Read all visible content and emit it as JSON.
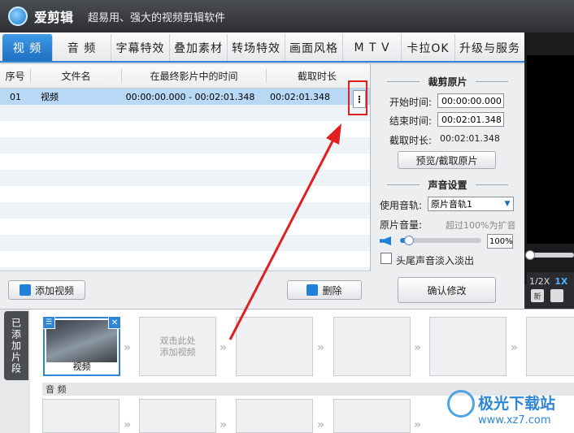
{
  "app": {
    "name": "爱剪辑",
    "slogan": "超易用、强大的视频剪辑软件"
  },
  "tabs": [
    {
      "label": "视 频",
      "active": true
    },
    {
      "label": "音 频",
      "active": false
    },
    {
      "label": "字幕特效",
      "active": false
    },
    {
      "label": "叠加素材",
      "active": false
    },
    {
      "label": "转场特效",
      "active": false
    },
    {
      "label": "画面风格",
      "active": false
    },
    {
      "label": "M T V",
      "active": false
    },
    {
      "label": "卡拉OK",
      "active": false
    },
    {
      "label": "升级与服务",
      "active": false
    }
  ],
  "table": {
    "headers": [
      "序号",
      "文件名",
      "在最终影片中的时间",
      "截取时长"
    ],
    "rows": [
      {
        "index": "01",
        "name": "视频",
        "time_range": "00:00:00.000 - 00:02:01.348",
        "duration": "00:02:01.348"
      }
    ],
    "more_button": "⋮"
  },
  "footer": {
    "add_video": "添加视频",
    "delete": "删除"
  },
  "trim": {
    "title": "裁剪原片",
    "start_label": "开始时间:",
    "start_value": "00:00:00.000",
    "end_label": "结束时间:",
    "end_value": "00:02:01.348",
    "duration_label": "截取时长:",
    "duration_value": "00:02:01.348",
    "preview_button": "预览/截取原片"
  },
  "audio": {
    "title": "声音设置",
    "track_label": "使用音轨:",
    "track_value": "原片音轨1",
    "volume_label": "原片音量:",
    "volume_hint": "超过100%为扩音",
    "volume_value": "100%",
    "volume_level": 0.1,
    "fade_label": "头尾声音淡入淡出",
    "confirm_button": "确认修改"
  },
  "preview": {
    "speeds": [
      "1/2X",
      "1X"
    ],
    "active_speed": "1X"
  },
  "timeline": {
    "added_label": "已添加片段",
    "clip_label": "视频",
    "add_hint_line1": "双击此处",
    "add_hint_line2": "添加视频",
    "audio_label": "音 频"
  },
  "watermark": {
    "text": "极光下载站",
    "url": "www.xz7.com"
  },
  "colors": {
    "accent": "#2f86d6",
    "highlight_box": "#e02020",
    "selected_row": "#b9d8f5"
  }
}
